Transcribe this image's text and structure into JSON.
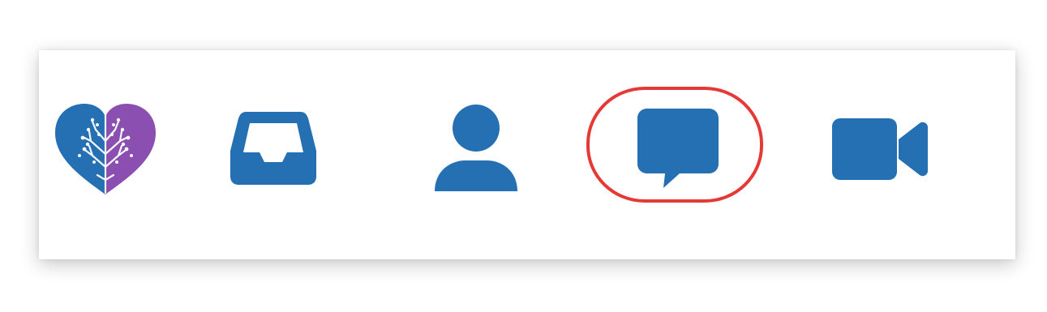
{
  "toolbar": {
    "items": [
      {
        "id": "logo",
        "icon": "heart-tree-logo-icon"
      },
      {
        "id": "inbox",
        "icon": "inbox-tray-icon"
      },
      {
        "id": "profile",
        "icon": "person-icon"
      },
      {
        "id": "messages",
        "icon": "chat-bubble-icon",
        "highlighted": true
      },
      {
        "id": "video",
        "icon": "video-camera-icon"
      }
    ],
    "colors": {
      "icon_blue": "#2470b3",
      "logo_purple": "#8a4fb0",
      "highlight_red": "#e53935"
    }
  }
}
